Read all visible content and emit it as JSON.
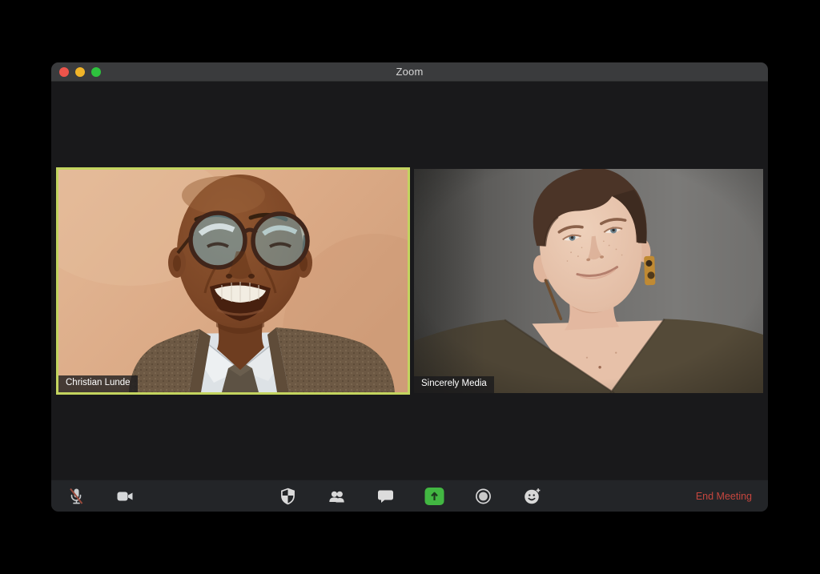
{
  "window": {
    "title": "Zoom"
  },
  "titlebar": {
    "buttons": [
      {
        "name": "close",
        "color": "#ed544b"
      },
      {
        "name": "minimize",
        "color": "#f0b429"
      },
      {
        "name": "zoom-fullscreen",
        "color": "#2ec23e"
      }
    ]
  },
  "meeting": {
    "participants": [
      {
        "name": "Christian Lunde",
        "active_speaker": true
      },
      {
        "name": "Sincerely Media",
        "active_speaker": false
      }
    ],
    "active_speaker_border_color": "#c3d45f"
  },
  "toolbar": {
    "buttons": [
      {
        "id": "mute",
        "icon": "microphone-muted-icon",
        "state": "muted",
        "slash_color": "#9a4a3c"
      },
      {
        "id": "video",
        "icon": "video-camera-icon",
        "state": "on"
      },
      {
        "id": "security",
        "icon": "shield-icon"
      },
      {
        "id": "participants",
        "icon": "participants-icon"
      },
      {
        "id": "chat",
        "icon": "chat-bubble-icon"
      },
      {
        "id": "share-screen",
        "icon": "share-screen-up-arrow-icon",
        "color": "#42b742"
      },
      {
        "id": "record",
        "icon": "record-icon"
      },
      {
        "id": "reactions",
        "icon": "reactions-smiley-plus-icon"
      }
    ],
    "end_meeting": {
      "label": "End Meeting",
      "color": "#c5463e"
    }
  }
}
